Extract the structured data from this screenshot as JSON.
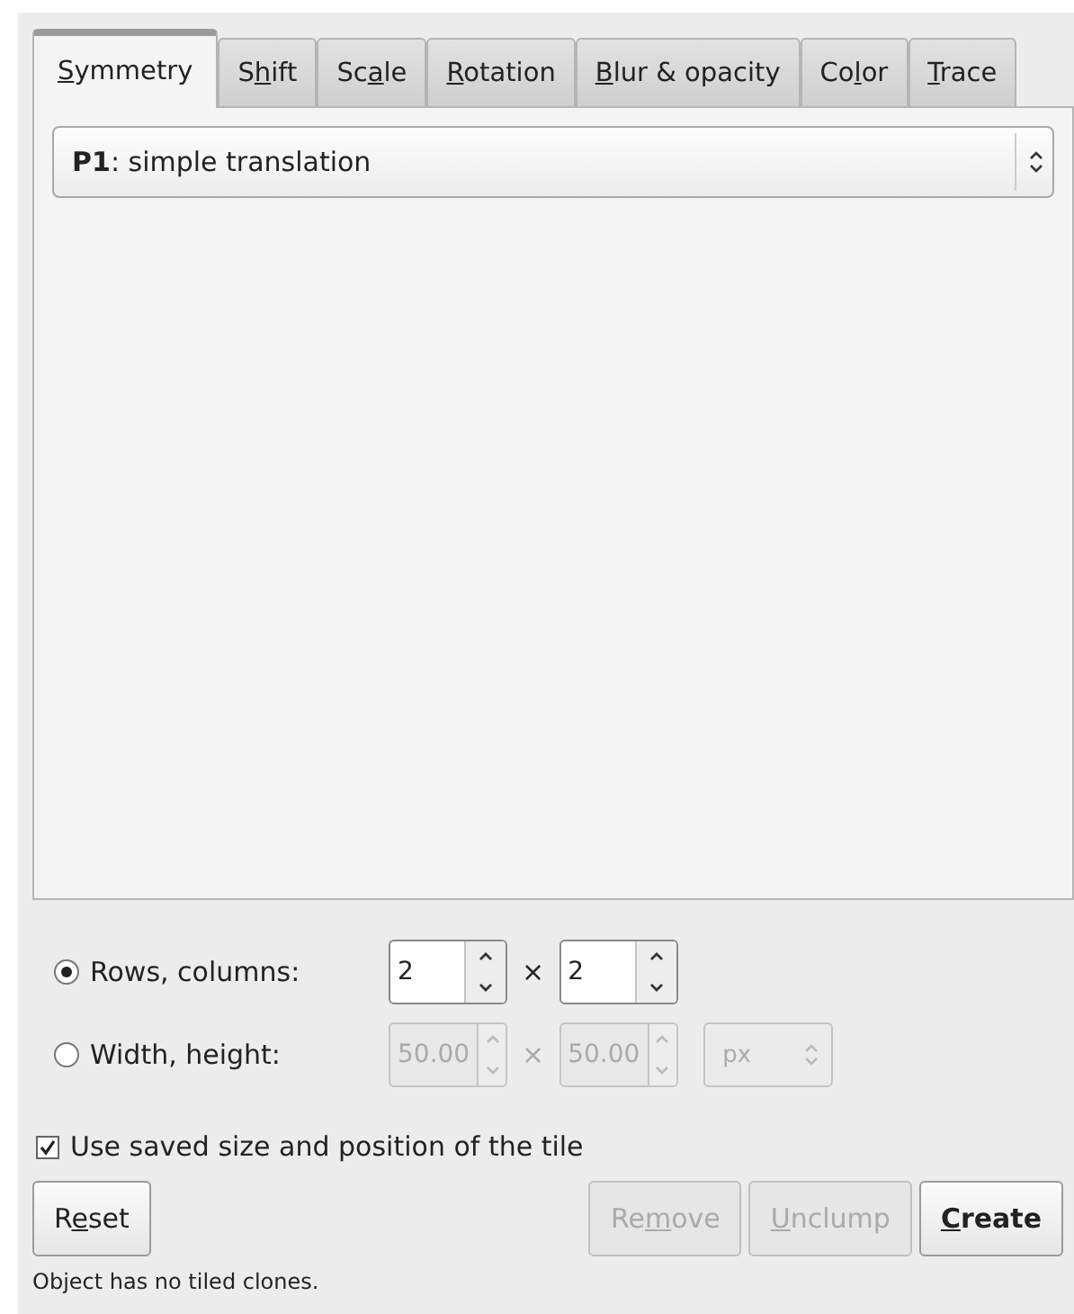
{
  "tabs": [
    {
      "key": "S",
      "post": "ymmetry",
      "selected": true
    },
    {
      "pre": "S",
      "key": "h",
      "post": "ift",
      "selected": false
    },
    {
      "pre": "Sc",
      "key": "a",
      "post": "le",
      "selected": false
    },
    {
      "key": "R",
      "post": "otation",
      "selected": false
    },
    {
      "key": "B",
      "post": "lur & opacity",
      "selected": false
    },
    {
      "pre": "Co",
      "key": "l",
      "post": "or",
      "selected": false
    },
    {
      "key": "T",
      "post": "race",
      "selected": false
    }
  ],
  "symmetry_select": {
    "value": "**P1**: simple translation"
  },
  "size_modes": [
    {
      "label": "Rows, columns:",
      "selected": true,
      "disabled": false,
      "fields": [
        "2",
        "2"
      ],
      "separator": "×"
    },
    {
      "label": "Width, height:",
      "selected": false,
      "disabled": true,
      "fields": [
        "50.00",
        "50.00"
      ],
      "separator": "×",
      "unit": "px"
    }
  ],
  "use_saved": {
    "label": "Use saved size and position of the tile",
    "checked": true
  },
  "buttons": [
    {
      "pre": "R",
      "key": "e",
      "post": "set",
      "disabled": false,
      "primary": false
    },
    {
      "pre": "Re",
      "key": "m",
      "post": "ove",
      "disabled": true,
      "primary": false
    },
    {
      "key": "U",
      "post": "nclump",
      "disabled": true,
      "primary": false
    },
    {
      "key": "C",
      "post": "reate",
      "disabled": false,
      "primary": true
    }
  ],
  "status": "Object has no tiled clones."
}
